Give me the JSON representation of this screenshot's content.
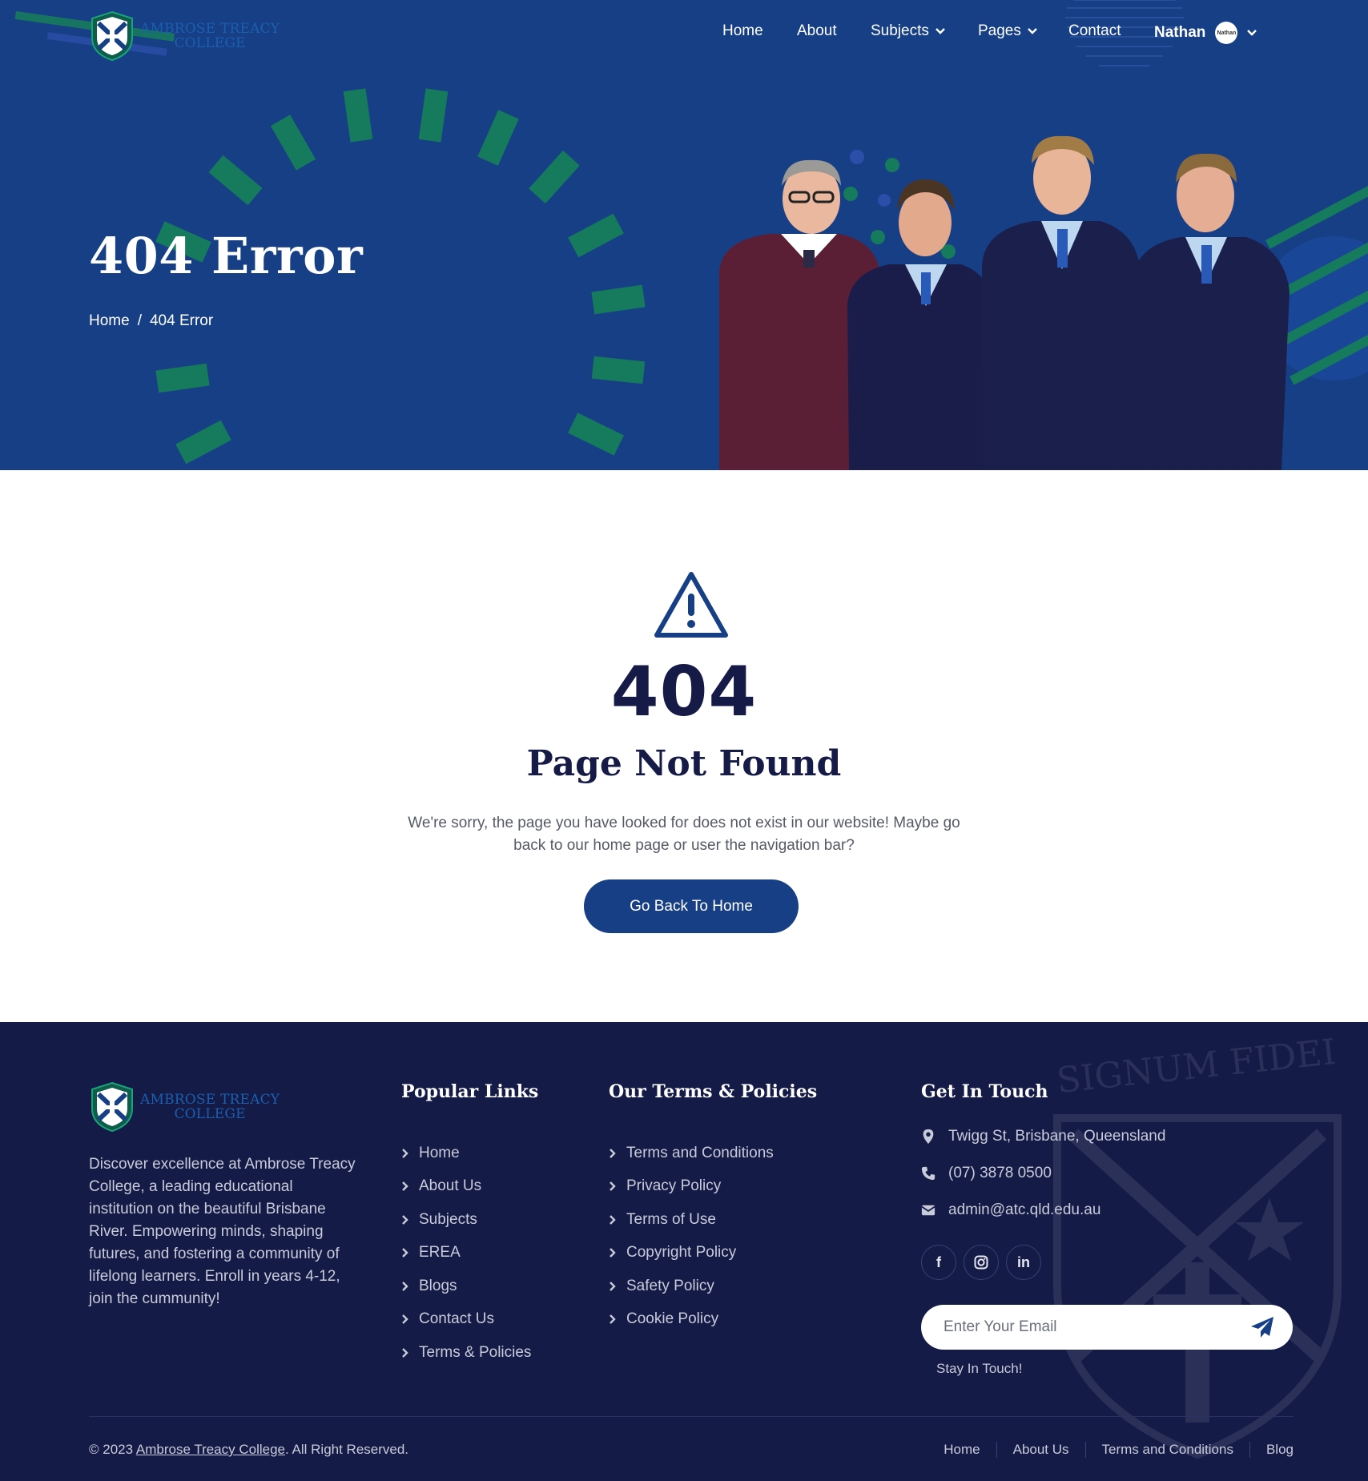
{
  "brand": {
    "name_line1": "AMBROSE TREACY",
    "name_line2": "COLLEGE",
    "colors": {
      "primary": "#163f86",
      "green": "#167a5c",
      "dark": "#151b47"
    }
  },
  "nav": {
    "items": [
      {
        "label": "Home"
      },
      {
        "label": "About"
      },
      {
        "label": "Subjects"
      },
      {
        "label": "Pages"
      },
      {
        "label": "Contact"
      }
    ],
    "user": {
      "name": "Nathan",
      "avatar_text": "Nathan"
    }
  },
  "hero": {
    "title": "404 Error",
    "breadcrumb": {
      "home": "Home",
      "separator": "/",
      "current": "404 Error"
    }
  },
  "error": {
    "icon": "warning-triangle-icon",
    "code": "404",
    "title": "Page Not Found",
    "message": "We're sorry, the page you have looked for does not exist in our website! Maybe go back to our home page or user the navigation bar?",
    "button_label": "Go Back To Home"
  },
  "footer": {
    "about": "Discover excellence at Ambrose Treacy College, a leading educational institution on the beautiful Brisbane River. Empowering minds, shaping futures, and fostering a community of lifelong learners. Enroll in years 4-12, join the cummunity!",
    "popular_links": {
      "heading": "Popular Links",
      "items": [
        "Home",
        "About Us",
        "Subjects",
        "EREA",
        "Blogs",
        "Contact Us",
        "Terms & Policies"
      ]
    },
    "policies": {
      "heading": "Our Terms & Policies",
      "items": [
        "Terms and Conditions",
        "Privacy Policy",
        "Terms of Use",
        "Copyright Policy",
        "Safety Policy",
        "Cookie Policy"
      ]
    },
    "contact": {
      "heading": "Get In Touch",
      "address": "Twigg St, Brisbane, Queensland",
      "phone": "(07) 3878 0500",
      "email": "admin@atc.qld.edu.au"
    },
    "social": [
      {
        "icon": "facebook-icon",
        "label": "f"
      },
      {
        "icon": "instagram-icon",
        "label": ""
      },
      {
        "icon": "linkedin-icon",
        "label": "in"
      }
    ],
    "subscribe": {
      "placeholder": "Enter Your Email",
      "note": "Stay In Touch!"
    },
    "copyright": {
      "prefix": "© 2023",
      "link": "Ambrose Treacy College",
      "suffix": ". All Right Reserved."
    },
    "bottom_links": [
      "Home",
      "About Us",
      "Terms and Conditions",
      "Blog"
    ],
    "watermark_text": "SIGNUM FIDEI"
  }
}
